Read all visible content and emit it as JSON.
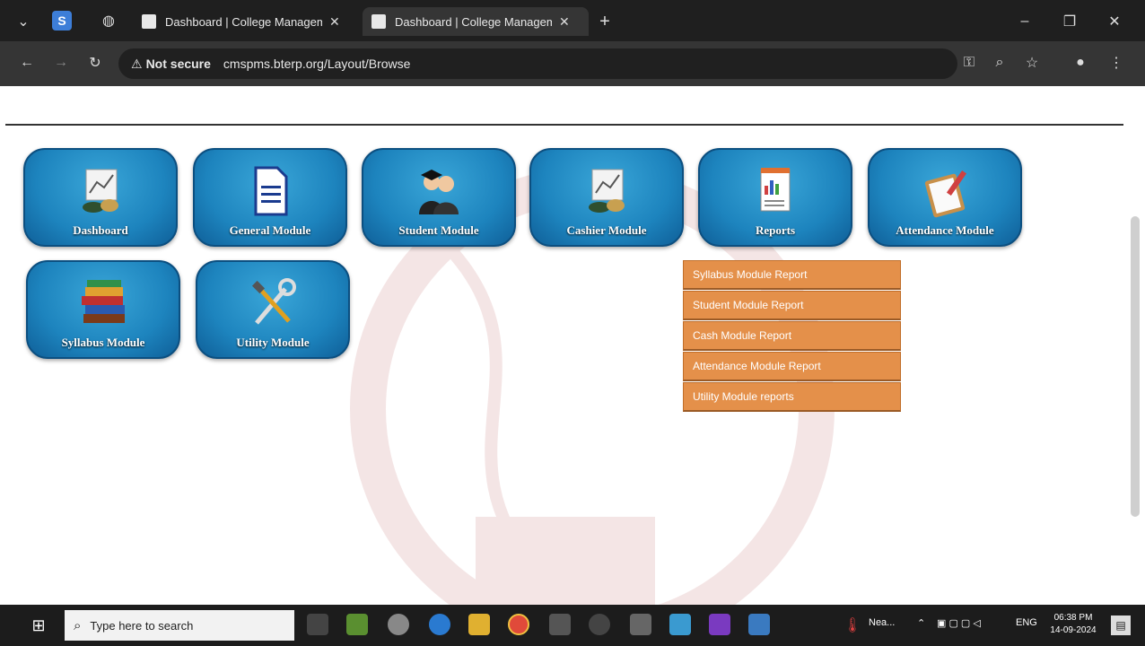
{
  "browser": {
    "tabs": [
      {
        "title": "Dashboard | College Managem"
      },
      {
        "title": "Dashboard | College Managem"
      }
    ],
    "security": "Not secure",
    "url": "cmspms.bterp.org/Layout/Browse"
  },
  "modules": [
    {
      "label": "Dashboard",
      "icon": "dashboard-chart-icon"
    },
    {
      "label": "General Module",
      "icon": "document-icon"
    },
    {
      "label": "Student Module",
      "icon": "students-icon"
    },
    {
      "label": "Cashier Module",
      "icon": "cashier-chart-icon"
    },
    {
      "label": "Reports",
      "icon": "report-icon"
    },
    {
      "label": "Attendance Module",
      "icon": "clipboard-icon"
    },
    {
      "label": "Syllabus Module",
      "icon": "books-icon"
    },
    {
      "label": "Utility Module",
      "icon": "tools-icon"
    }
  ],
  "reports_menu": [
    "Syllabus Module Report",
    "Student Module Report",
    "Cash Module Report",
    "Attendance Module Report",
    "Utility Module reports"
  ],
  "taskbar": {
    "search_placeholder": "Type here to search",
    "weather": "Nea...",
    "language": "ENG",
    "time": "06:38 PM",
    "date": "14-09-2024"
  },
  "colors": {
    "module_blue": "#1d84be",
    "menu_orange": "#e4904a"
  }
}
